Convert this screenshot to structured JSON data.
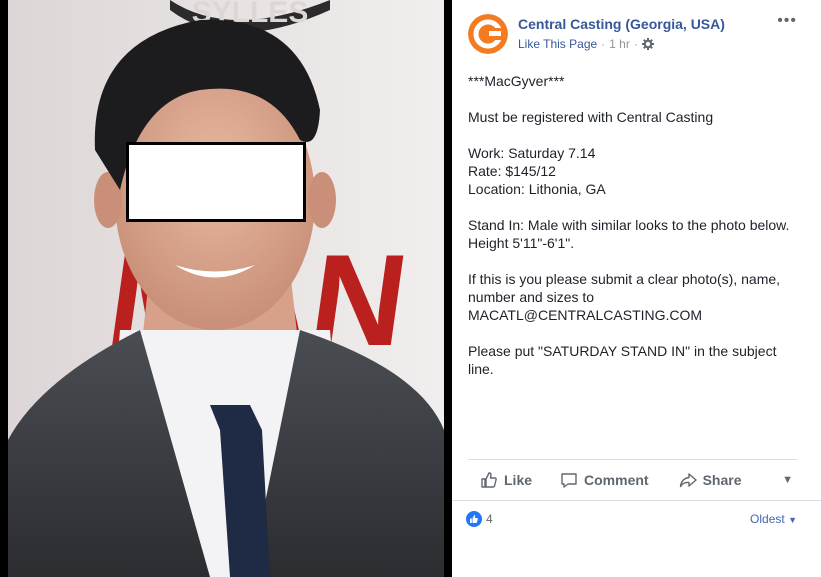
{
  "post": {
    "page_name": "Central Casting (Georgia, USA)",
    "like_link": "Like This Page",
    "time_sep": "·",
    "time": "1 hr",
    "time_sep2": "·",
    "lines": [
      "***MacGyver***",
      "",
      "Must be registered with Central Casting",
      "",
      "Work: Saturday 7.14",
      "Rate: $145/12",
      "Location: Lithonia, GA",
      "",
      "Stand In: Male with similar looks to the photo below.",
      "Height 5'11\"-6'1\".",
      "",
      "If this is you please submit a clear photo(s), name,",
      "number and sizes to",
      "MACATL@CENTRALCASTING.COM",
      "",
      "Please put \"SATURDAY STAND IN\" in the subject",
      "line."
    ]
  },
  "actions": {
    "like": "Like",
    "comment": "Comment",
    "share": "Share"
  },
  "footer": {
    "reaction_count": "4",
    "sort_label": "Oldest"
  },
  "photo": {
    "backdrop_text_top": "SYLLES",
    "backdrop_text_main": "MAN"
  },
  "colors": {
    "brand_orange": "#f47b20",
    "link_blue": "#365899",
    "like_blue": "#2078f4"
  }
}
